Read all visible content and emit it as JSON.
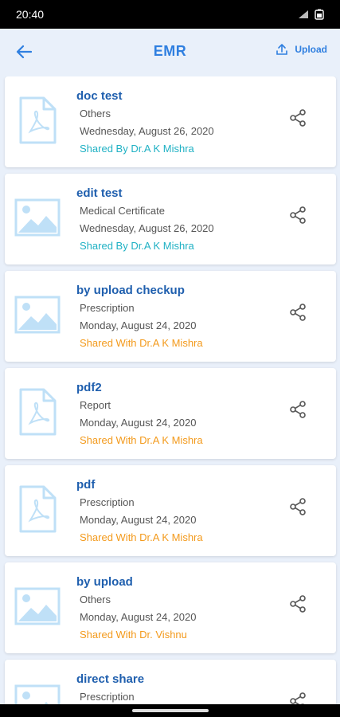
{
  "status_bar": {
    "time": "20:40"
  },
  "header": {
    "title": "EMR",
    "upload_label": "Upload"
  },
  "colors": {
    "accent": "#2f7fe0",
    "shared_by": "#1fb1c4",
    "shared_with": "#f39a1c",
    "thumb": "#bfe0f7"
  },
  "records": [
    {
      "name": "doc test",
      "category": "Others",
      "date": "Wednesday, August 26, 2020",
      "shared": "Shared By Dr.A K Mishra",
      "shared_type": "by",
      "icon": "pdf-icon"
    },
    {
      "name": "edit test",
      "category": "Medical Certificate",
      "date": "Wednesday, August 26, 2020",
      "shared": "Shared By Dr.A K Mishra",
      "shared_type": "by",
      "icon": "image-icon"
    },
    {
      "name": "by upload checkup",
      "category": "Prescription",
      "date": "Monday, August 24, 2020",
      "shared": "Shared With Dr.A K Mishra",
      "shared_type": "with",
      "icon": "image-icon"
    },
    {
      "name": "pdf2",
      "category": "Report",
      "date": "Monday, August 24, 2020",
      "shared": "Shared With Dr.A K Mishra",
      "shared_type": "with",
      "icon": "pdf-icon"
    },
    {
      "name": "pdf",
      "category": "Prescription",
      "date": "Monday, August 24, 2020",
      "shared": "Shared With Dr.A K Mishra",
      "shared_type": "with",
      "icon": "pdf-icon"
    },
    {
      "name": "by upload",
      "category": "Others",
      "date": "Monday, August 24, 2020",
      "shared": "Shared With Dr. Vishnu",
      "shared_type": "with",
      "icon": "image-icon"
    },
    {
      "name": "direct share",
      "category": "Prescription",
      "date": "",
      "shared": "",
      "shared_type": "with",
      "icon": "image-icon"
    }
  ]
}
